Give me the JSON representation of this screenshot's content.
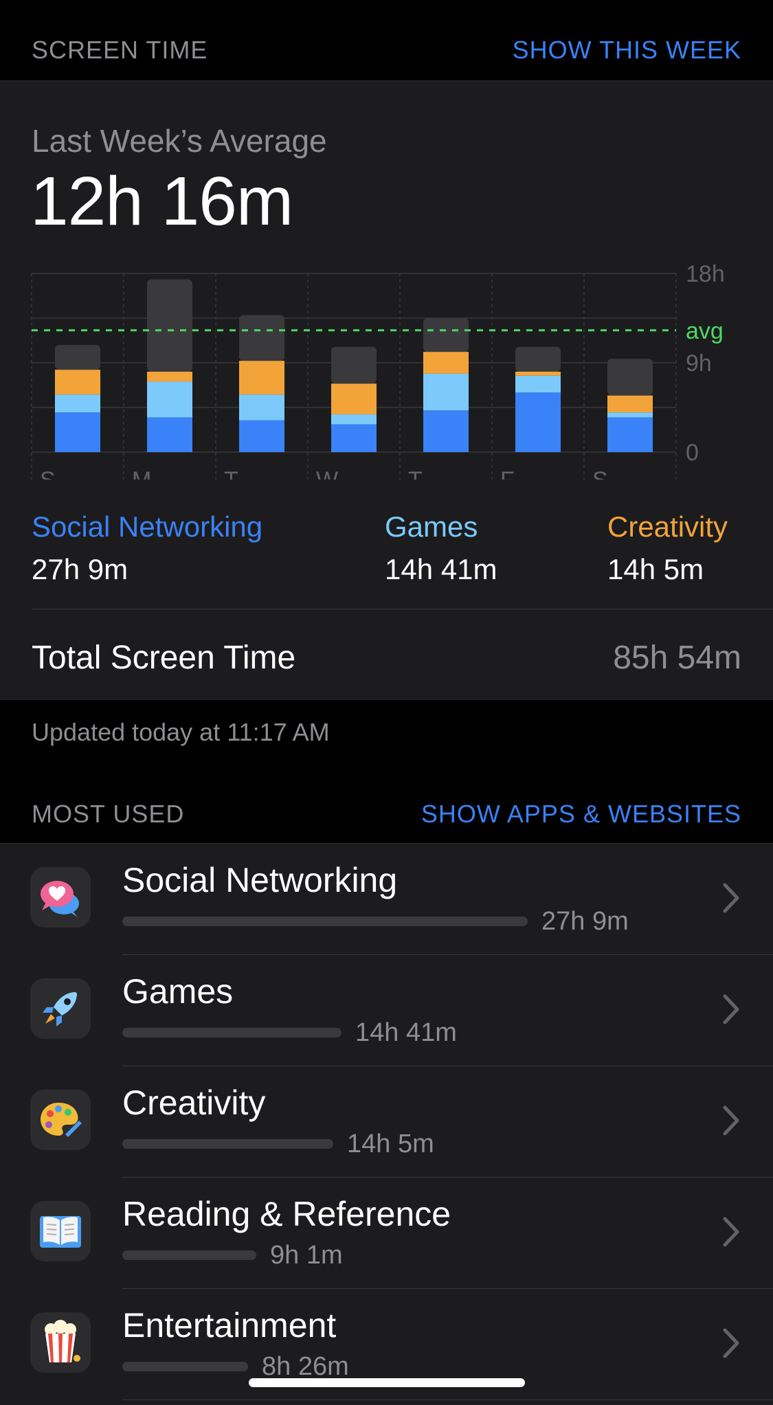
{
  "header": {
    "title": "SCREEN TIME",
    "action": "SHOW THIS WEEK"
  },
  "summary": {
    "label": "Last Week’s Average",
    "value": "12h 16m"
  },
  "colors": {
    "social": "#3a82f7",
    "games": "#7ccafc",
    "creativity": "#f2a43a",
    "other": "#3a3a3c",
    "avg_line": "#4cd964",
    "accent": "#3a82f7"
  },
  "chart_data": {
    "type": "bar",
    "stacked": true,
    "categories": [
      "S",
      "M",
      "T",
      "W",
      "T",
      "F",
      "S"
    ],
    "series": [
      {
        "name": "Social Networking",
        "values": [
          4.0,
          3.5,
          3.2,
          2.8,
          4.2,
          6.0,
          3.5
        ]
      },
      {
        "name": "Games",
        "values": [
          1.8,
          3.6,
          2.6,
          1.0,
          3.7,
          1.7,
          0.5
        ]
      },
      {
        "name": "Creativity",
        "values": [
          2.5,
          1.0,
          3.4,
          3.1,
          2.2,
          0.4,
          1.7
        ]
      },
      {
        "name": "Other",
        "values": [
          2.5,
          9.3,
          4.6,
          3.7,
          3.4,
          2.5,
          3.7
        ]
      }
    ],
    "ylim": [
      0,
      18
    ],
    "yticks": [
      "0",
      "9h",
      "18h"
    ],
    "avg_value": 12.27,
    "avg_label": "avg",
    "grid": true
  },
  "legend": [
    {
      "name": "Social Networking",
      "value": "27h 9m"
    },
    {
      "name": "Games",
      "value": "14h 41m"
    },
    {
      "name": "Creativity",
      "value": "14h 5m"
    }
  ],
  "total": {
    "label": "Total Screen Time",
    "value": "85h 54m"
  },
  "updated": "Updated today at 11:17 AM",
  "most_used": {
    "title": "MOST USED",
    "action": "SHOW APPS & WEBSITES",
    "items": [
      {
        "name": "Social Networking",
        "time": "27h 9m",
        "fraction": 1.0,
        "icon": "social-icon"
      },
      {
        "name": "Games",
        "time": "14h 41m",
        "fraction": 0.54,
        "icon": "rocket-icon"
      },
      {
        "name": "Creativity",
        "time": "14h 5m",
        "fraction": 0.52,
        "icon": "palette-icon"
      },
      {
        "name": "Reading & Reference",
        "time": "9h 1m",
        "fraction": 0.33,
        "icon": "book-icon"
      },
      {
        "name": "Entertainment",
        "time": "8h 26m",
        "fraction": 0.31,
        "icon": "popcorn-icon"
      }
    ]
  }
}
